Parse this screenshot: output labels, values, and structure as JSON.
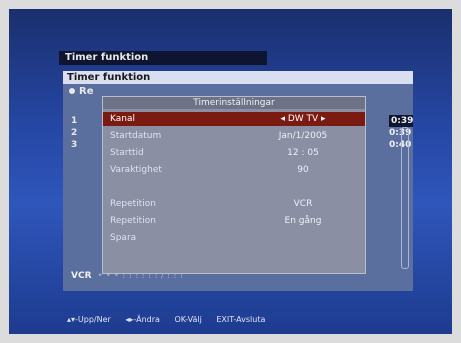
{
  "window": {
    "title": "Timer funktion"
  },
  "panel": {
    "title": "Timer funktion",
    "subtitle": "Re",
    "rows": [
      "1",
      "2",
      "3"
    ],
    "times": [
      "0:39",
      "0:39",
      "0:40"
    ],
    "bottom_left": "VCR",
    "bottom_rest": "• • •   ! ! !   ! ! !  /  ! ! !"
  },
  "dialog": {
    "title": "Timerinställningar",
    "rows": [
      {
        "label": "Kanal",
        "value": "◂ DW TV ▸",
        "selected": true
      },
      {
        "label": "Startdatum",
        "value": "Jan/1/2005"
      },
      {
        "label": "Starttid",
        "value": "12 : 05"
      },
      {
        "label": "Varaktighet",
        "value": "90"
      },
      {
        "label": "",
        "value": "",
        "dim": true
      },
      {
        "label": "Repetition",
        "value": "VCR"
      },
      {
        "label": "Repetition",
        "value": "En gång"
      },
      {
        "label": "Spara",
        "value": ""
      }
    ]
  },
  "help": {
    "updown": "▴▾-Upp/Ner",
    "change": "◂▸-Ändra",
    "ok": "OK-Välj",
    "exit": "EXIT-Avsluta"
  },
  "colors": {
    "highlight": "#7a1a10",
    "screen_bg": "#2546a2"
  }
}
